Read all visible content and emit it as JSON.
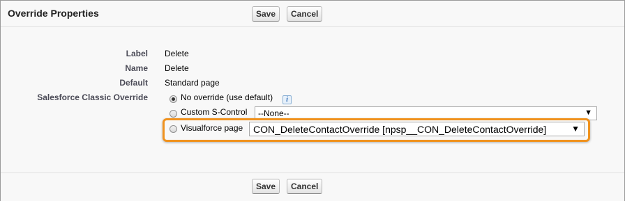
{
  "header": {
    "title": "Override Properties",
    "save_label": "Save",
    "cancel_label": "Cancel"
  },
  "fields": {
    "label": {
      "label": "Label",
      "value": "Delete"
    },
    "name": {
      "label": "Name",
      "value": "Delete"
    },
    "default": {
      "label": "Default",
      "value": "Standard page"
    },
    "classic_override": {
      "label": "Salesforce Classic Override"
    }
  },
  "options": {
    "no_override": {
      "label": "No override (use default)",
      "checked": true,
      "info_icon": "i"
    },
    "s_control": {
      "label": "Custom S-Control",
      "checked": false,
      "selected": "--None--"
    },
    "visualforce": {
      "label": "Visualforce page",
      "checked": false,
      "selected": "CON_DeleteContactOverride [npsp__CON_DeleteContactOverride]"
    }
  },
  "footer": {
    "save_label": "Save",
    "cancel_label": "Cancel"
  },
  "colors": {
    "highlight": "#f0921e",
    "label_text": "#4a4a56",
    "background": "#f8f8f8"
  }
}
